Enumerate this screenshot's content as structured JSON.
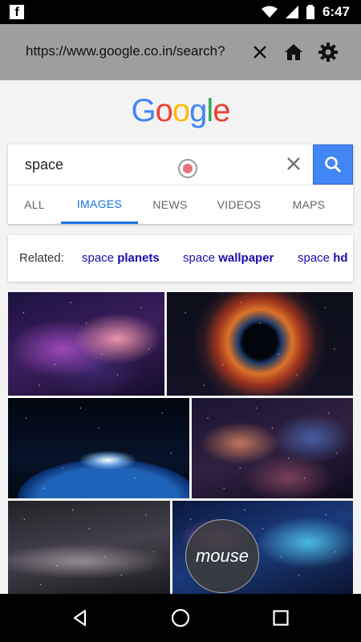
{
  "status_bar": {
    "time": "6:47",
    "app_icon": "facebook-icon",
    "icons": [
      "wifi-icon",
      "signal-icon",
      "battery-icon"
    ]
  },
  "url_bar": {
    "url": "https://www.google.co.in/search?",
    "icons": [
      "close-icon",
      "home-icon",
      "gear-icon"
    ]
  },
  "logo": {
    "letters": [
      "G",
      "o",
      "o",
      "g",
      "l",
      "e"
    ],
    "colors": [
      "#4285f4",
      "#ea4335",
      "#fbbc05",
      "#4285f4",
      "#34a853",
      "#ea4335"
    ]
  },
  "search": {
    "query": "space",
    "clear_icon": "clear-icon",
    "search_icon": "search-icon"
  },
  "tabs": [
    "ALL",
    "IMAGES",
    "NEWS",
    "VIDEOS",
    "MAPS"
  ],
  "active_tab": "IMAGES",
  "related": {
    "label": "Related:",
    "chips": [
      {
        "prefix": "space",
        "bold": "planets"
      },
      {
        "prefix": "space",
        "bold": "wallpaper"
      },
      {
        "prefix": "space",
        "bold": "hd"
      }
    ]
  },
  "overlay": {
    "label": "mouse"
  },
  "colors": {
    "accent": "#1a73e8",
    "search_button": "#4285f4",
    "chip_link": "#1a0dab"
  },
  "nav_icons": [
    "back-icon",
    "home-circle-icon",
    "recents-icon"
  ]
}
